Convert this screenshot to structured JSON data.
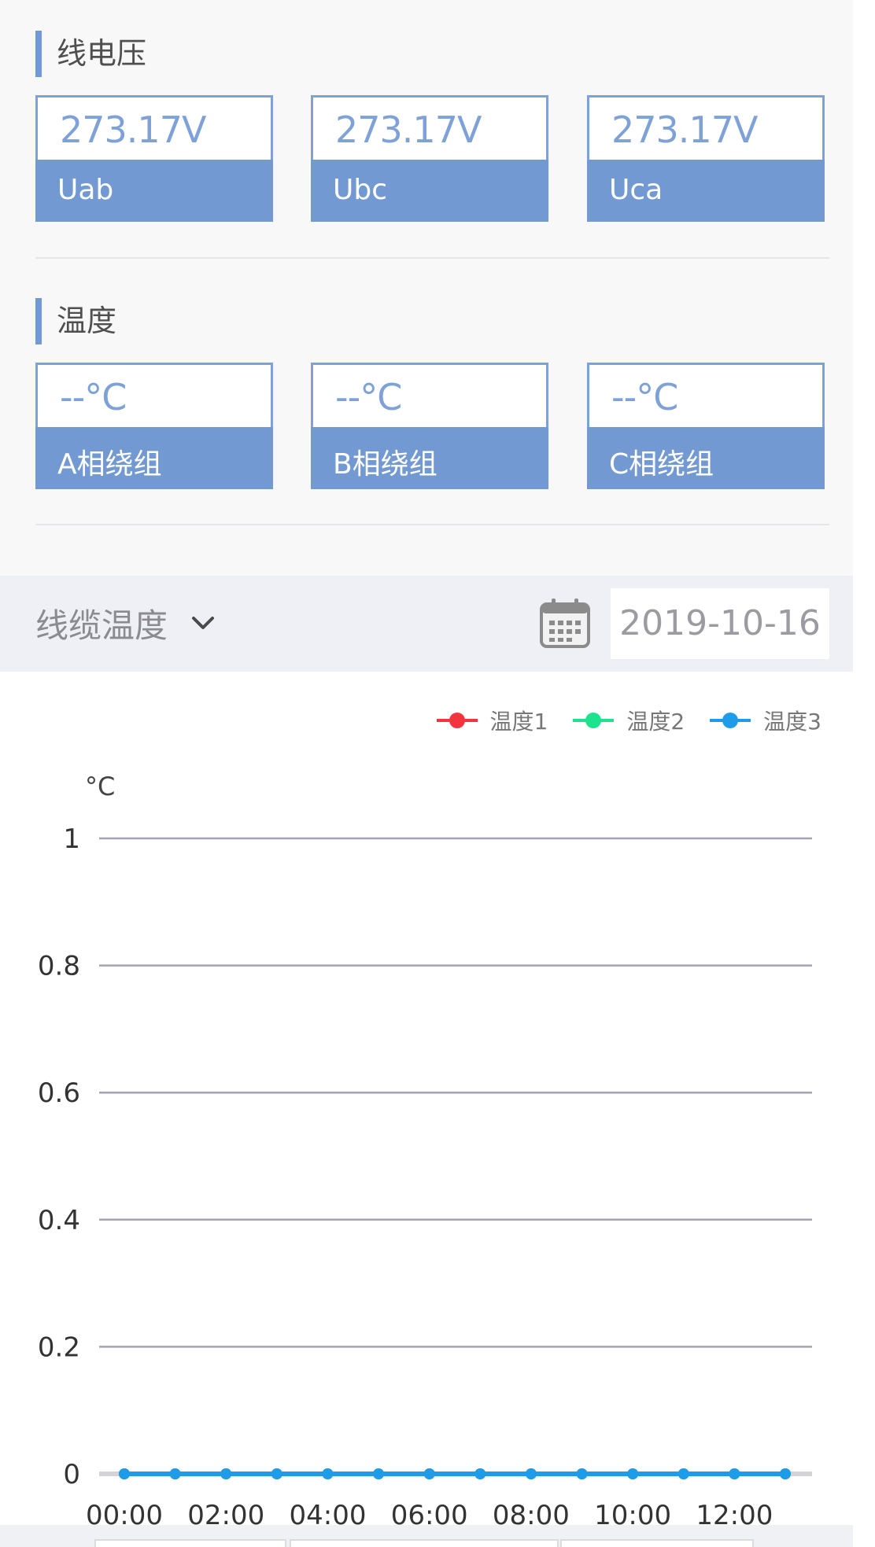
{
  "voltage": {
    "title": "线电压",
    "cards": [
      {
        "value": "273.17V",
        "label": "Uab"
      },
      {
        "value": "273.17V",
        "label": "Ubc"
      },
      {
        "value": "273.17V",
        "label": "Uca"
      }
    ]
  },
  "temperature": {
    "title": "温度",
    "cards": [
      {
        "value": "--°C",
        "label": "A相绕组"
      },
      {
        "value": "--°C",
        "label": "B相绕组"
      },
      {
        "value": "--°C",
        "label": "C相绕组"
      }
    ]
  },
  "selector": {
    "dropdown_label": "线缆温度",
    "date": "2019-10-16"
  },
  "colors": {
    "accent": "#7399d2",
    "series1": "#f5333f",
    "series2": "#1ee38e",
    "series3": "#1e9be9"
  },
  "icons": {
    "dropdown": "chevron-down-icon",
    "date": "calendar-icon"
  },
  "chart_data": {
    "type": "line",
    "title": "",
    "xlabel": "",
    "ylabel": "°C",
    "ylim": [
      0,
      1
    ],
    "y_ticks": [
      "1",
      "0.8",
      "0.6",
      "0.4",
      "0.2",
      "0"
    ],
    "x": [
      "00:00",
      "01:00",
      "02:00",
      "03:00",
      "04:00",
      "05:00",
      "06:00",
      "07:00",
      "08:00",
      "09:00",
      "10:00",
      "11:00",
      "12:00",
      "13:00"
    ],
    "x_tick_labels": [
      "00:00",
      "02:00",
      "04:00",
      "06:00",
      "08:00",
      "10:00",
      "12:00"
    ],
    "grid": true,
    "legend_position": "top-right",
    "series": [
      {
        "name": "温度1",
        "color": "#f5333f",
        "values": [
          0,
          0,
          0,
          0,
          0,
          0,
          0,
          0,
          0,
          0,
          0,
          0,
          0,
          0
        ]
      },
      {
        "name": "温度2",
        "color": "#1ee38e",
        "values": [
          0,
          0,
          0,
          0,
          0,
          0,
          0,
          0,
          0,
          0,
          0,
          0,
          0,
          0
        ]
      },
      {
        "name": "温度3",
        "color": "#1e9be9",
        "values": [
          0,
          0,
          0,
          0,
          0,
          0,
          0,
          0,
          0,
          0,
          0,
          0,
          0,
          0
        ]
      }
    ]
  }
}
